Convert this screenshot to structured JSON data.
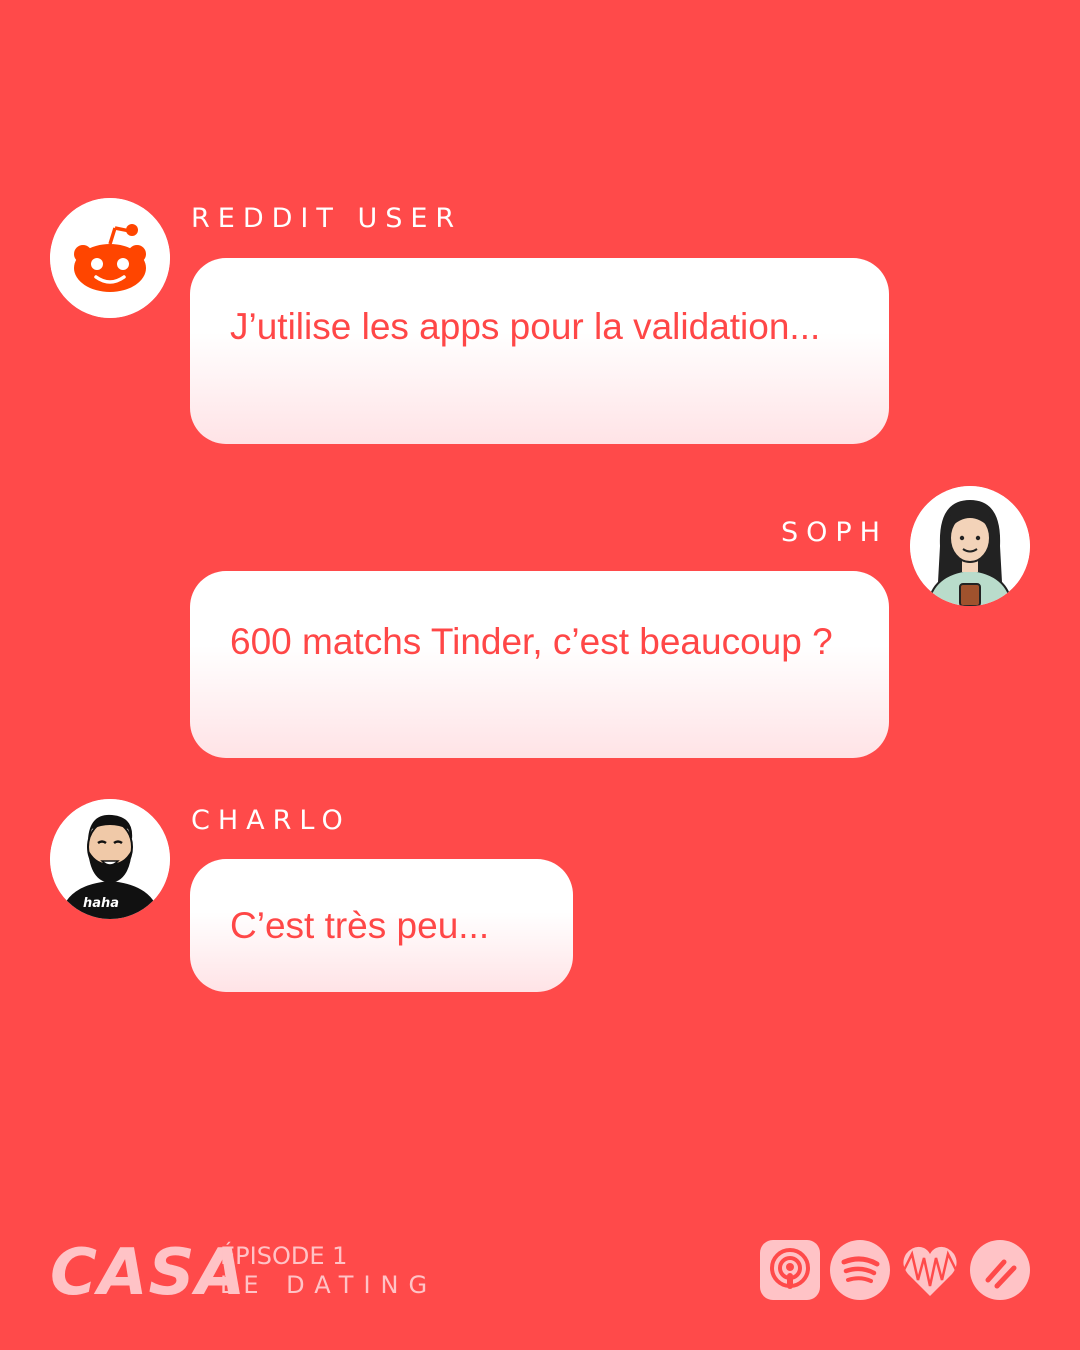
{
  "messages": [
    {
      "author": "REDDIT USER",
      "avatar_icon": "reddit-icon",
      "text": "J’utilise les apps pour la validation..."
    },
    {
      "author": "SOPH",
      "avatar_icon": "woman-illustration-avatar",
      "text": "600 matchs Tinder, c’est beaucoup ?"
    },
    {
      "author": "CHARLO",
      "avatar_icon": "bearded-man-illustration-avatar",
      "shirt_text": "haha",
      "text": "C’est très peu..."
    }
  ],
  "footer": {
    "logo": "CASA",
    "episode_number": "ÉPISODE 1",
    "episode_title": "LE DATING",
    "platforms": [
      "apple-podcasts-icon",
      "spotify-icon",
      "iheartradio-icon",
      "ohdio-icon"
    ]
  },
  "colors": {
    "background": "#ff4a4a",
    "bubble_text": "#ff4747",
    "footer_pink": "#ffc3c6",
    "reddit_orange": "#ff4500"
  }
}
